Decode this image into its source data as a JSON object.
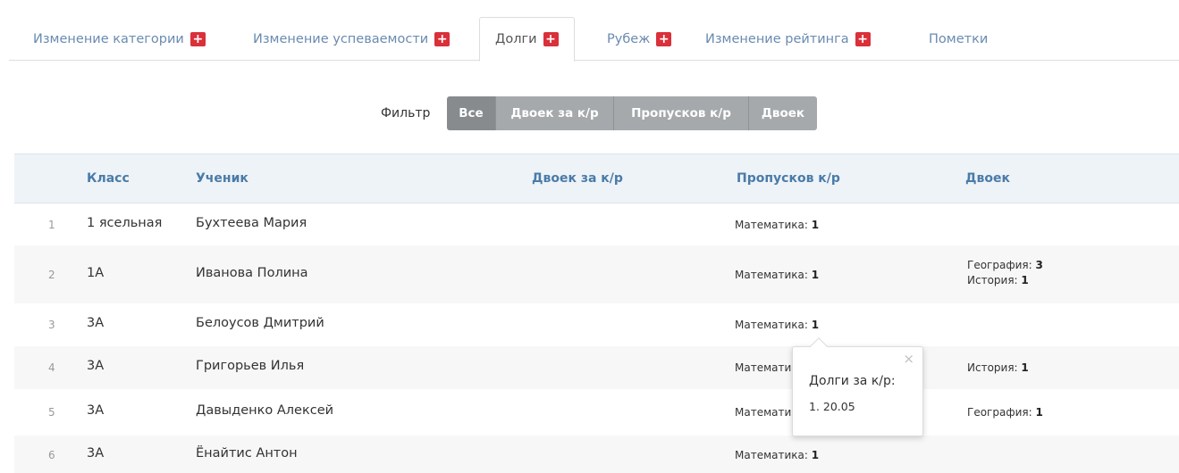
{
  "tabs": [
    {
      "label": "Изменение категории",
      "badge": "+"
    },
    {
      "label": "Изменение успеваемости",
      "badge": "+"
    },
    {
      "label": "Долги",
      "badge": "+"
    },
    {
      "label": "Рубеж",
      "badge": "+"
    },
    {
      "label": "Изменение рейтинга",
      "badge": "+"
    },
    {
      "label": "Пометки"
    }
  ],
  "filter": {
    "label": "Фильтр",
    "buttons": [
      "Все",
      "Двоек за к/р",
      "Пропусков к/р",
      "Двоек"
    ]
  },
  "table": {
    "headers": [
      "Класс",
      "Ученик",
      "Двоек за к/р",
      "Пропусков к/р",
      "Двоек"
    ],
    "rows": [
      {
        "n": "1",
        "class": "1 ясельная",
        "student": "Бухтеева Мария",
        "skips": [
          {
            "subject": "Математика:",
            "count": "1"
          }
        ],
        "twos": []
      },
      {
        "n": "2",
        "class": "1А",
        "student": "Иванова Полина",
        "skips": [
          {
            "subject": "Математика:",
            "count": "1"
          }
        ],
        "twos": [
          {
            "subject": "География:",
            "count": "3"
          },
          {
            "subject": "История:",
            "count": "1"
          }
        ]
      },
      {
        "n": "3",
        "class": "3А",
        "student": "Белоусов Дмитрий",
        "skips": [
          {
            "subject": "Математика:",
            "count": "1"
          }
        ],
        "twos": []
      },
      {
        "n": "4",
        "class": "3А",
        "student": "Григорьев Илья",
        "skips": [
          {
            "subject": "Математи",
            "count": ""
          }
        ],
        "twos": [
          {
            "subject": "История:",
            "count": "1"
          }
        ]
      },
      {
        "n": "5",
        "class": "3А",
        "student": "Давыденко Алексей",
        "skips": [
          {
            "subject": "Математи",
            "count": ""
          }
        ],
        "twos": [
          {
            "subject": "География:",
            "count": "1"
          }
        ]
      },
      {
        "n": "6",
        "class": "3А",
        "student": "Ёнайтис Антон",
        "skips": [
          {
            "subject": "Математика:",
            "count": "1"
          }
        ],
        "twos": []
      }
    ]
  },
  "popover": {
    "close": "×",
    "title": "Долги за к/р:",
    "items": [
      "1. 20.05"
    ]
  }
}
